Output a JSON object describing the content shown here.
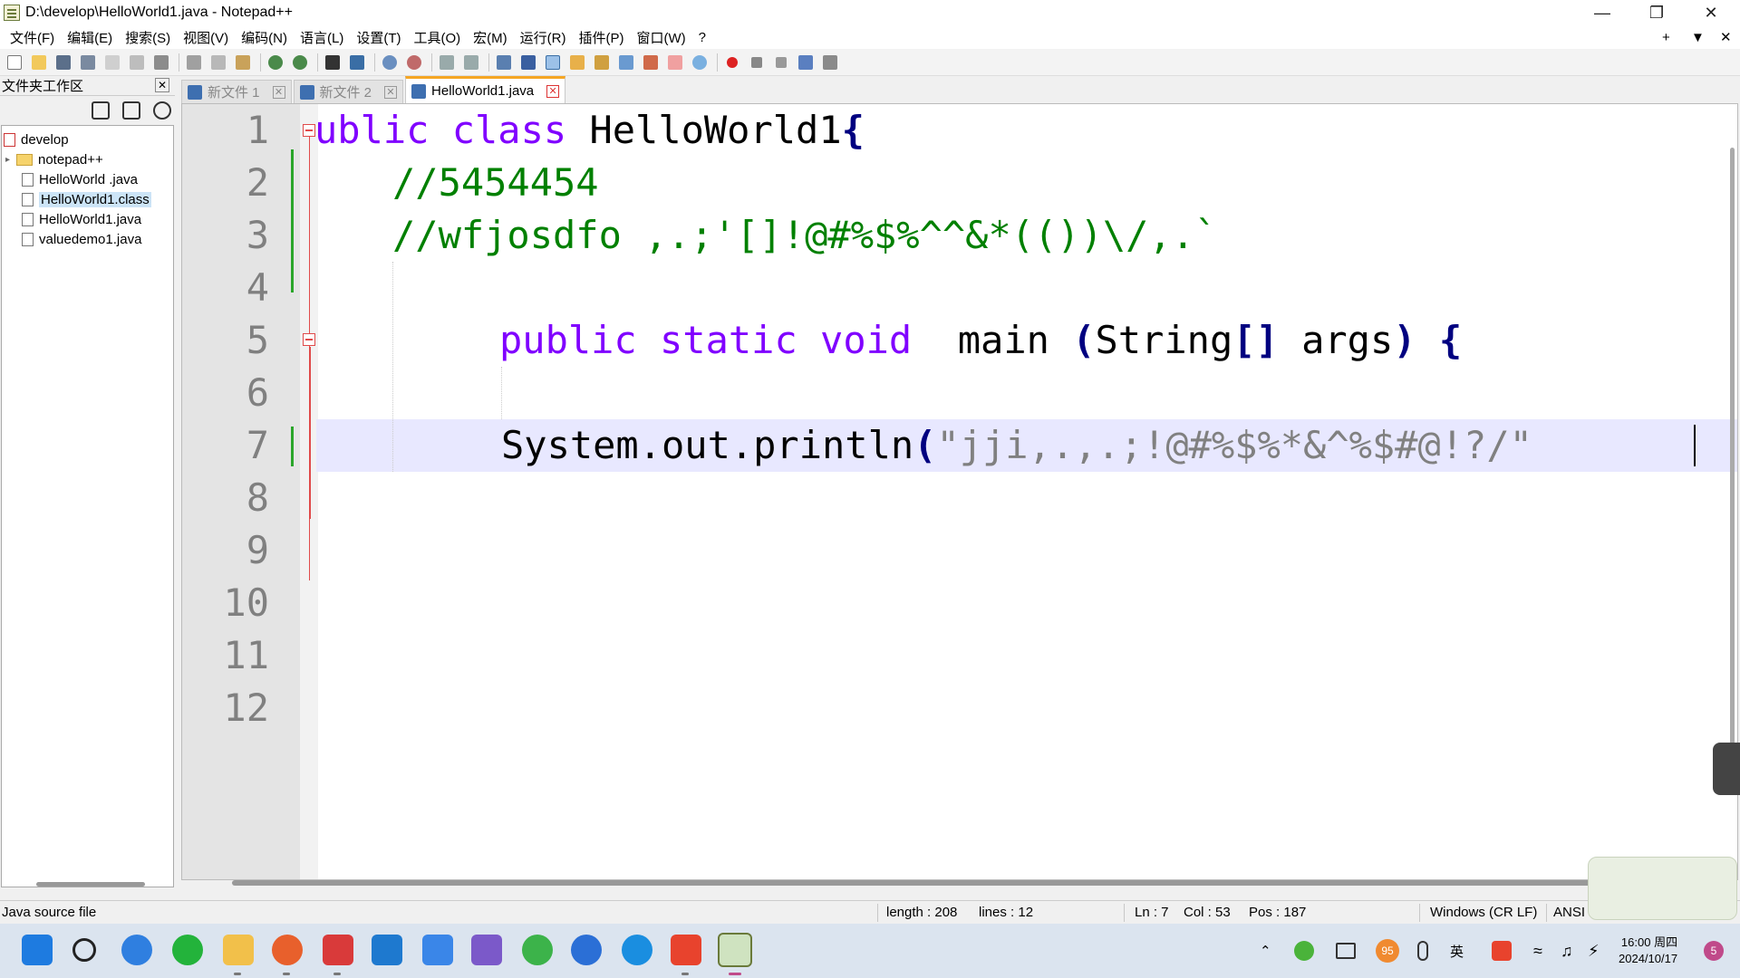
{
  "window": {
    "title": "D:\\develop\\HelloWorld1.java - Notepad++"
  },
  "menu": {
    "items": [
      "文件(F)",
      "编辑(E)",
      "搜索(S)",
      "视图(V)",
      "编码(N)",
      "语言(L)",
      "设置(T)",
      "工具(O)",
      "宏(M)",
      "运行(R)",
      "插件(P)",
      "窗口(W)",
      "?"
    ],
    "right_plus": "+",
    "right_down": "▼",
    "right_close": "✕"
  },
  "workspace": {
    "title": "文件夹工作区",
    "close": "✕",
    "tree": [
      {
        "label": "develop",
        "level": 0,
        "kind": "root"
      },
      {
        "label": "notepad++",
        "level": 1,
        "kind": "folder"
      },
      {
        "label": "HelloWorld .java",
        "level": 1,
        "kind": "file"
      },
      {
        "label": "HelloWorld1.class",
        "level": 1,
        "kind": "file",
        "selected": true
      },
      {
        "label": "HelloWorld1.java",
        "level": 1,
        "kind": "file"
      },
      {
        "label": "valuedemo1.java",
        "level": 1,
        "kind": "file"
      }
    ]
  },
  "tabs": [
    {
      "label": "新文件 1",
      "active": false
    },
    {
      "label": "新文件 2",
      "active": false
    },
    {
      "label": "HelloWorld1.java",
      "active": true
    }
  ],
  "editor": {
    "line_numbers": [
      "1",
      "2",
      "3",
      "4",
      "5",
      "6",
      "7",
      "8",
      "9",
      "10",
      "11",
      "12"
    ],
    "line1": {
      "kw1": "ublic",
      "kw2": "class",
      "name": "HelloWorld1",
      "brace": "{"
    },
    "line2": {
      "comment": "//5454454"
    },
    "line3": {
      "comment": "//wfjosdfo ,.;'[]!@#%$%^^&*(())\\/,.`"
    },
    "line5": {
      "kw1": "public",
      "kw2": "static",
      "kw3": "void",
      "name": "main",
      "open": "(",
      "type": "String",
      "arr": "[]",
      "param": "args",
      "close": ")",
      "brace": "{"
    },
    "line7": {
      "call": "System.out.println",
      "open": "(",
      "string": "\"jji,.,.;!@#%$%*&^%$#@!?/\""
    }
  },
  "status": {
    "file_type": "Java source file",
    "length": "length : 208",
    "lines": "lines : 12",
    "ln": "Ln : 7",
    "col": "Col : 53",
    "pos": "Pos : 187",
    "eol": "Windows (CR LF)",
    "encoding": "ANSI"
  },
  "taskbar": {
    "badge": "95",
    "ime": "英",
    "time": "16:00 周四",
    "date": "2024/10/17",
    "notification_count": "5"
  },
  "colors": {
    "keyword": "#8000ff",
    "comment": "#008000",
    "operator": "#000080",
    "string": "#808080",
    "active_tab_accent": "#f5a623"
  }
}
